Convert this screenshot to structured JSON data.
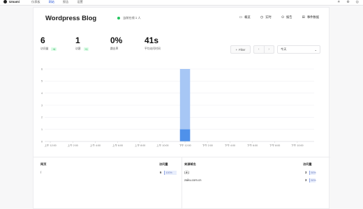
{
  "topbar": {
    "brand": "Umami",
    "nav": [
      "仪表板",
      "网站",
      "报告",
      "设置"
    ],
    "active_nav": 1
  },
  "site": {
    "title": "Wordpress Blog",
    "live": "当前在线 1 人"
  },
  "actions": [
    {
      "icon": "overview-icon",
      "glyph": "▭",
      "label": "概览"
    },
    {
      "icon": "realtime-icon",
      "glyph": "◷",
      "label": "实时"
    },
    {
      "icon": "reports-icon",
      "glyph": "⊙",
      "label": "报告"
    },
    {
      "icon": "events-icon",
      "glyph": "⊞",
      "label": "事件数据"
    }
  ],
  "stats": [
    {
      "value": "6",
      "label": "访问量",
      "badge": "+6"
    },
    {
      "value": "1",
      "label": "访客",
      "badge": "+1"
    },
    {
      "value": "0%",
      "label": "跳出率",
      "badge": ""
    },
    {
      "value": "41s",
      "label": "平均访问时间",
      "badge": ""
    }
  ],
  "filter": {
    "label": "Filter"
  },
  "period": {
    "value": "今天"
  },
  "chart_data": {
    "type": "bar",
    "categories": [
      "上午 12:00",
      "上午 2:00",
      "上午 4:00",
      "上午 6:00",
      "上午 8:00",
      "上午 10:00",
      "下午 12:00",
      "下午 2:00",
      "下午 4:00",
      "下午 6:00",
      "下午 8:00",
      "下午 10:00"
    ],
    "y_ticks": [
      0,
      1,
      2,
      3,
      4,
      5,
      6
    ],
    "ylim": [
      0,
      6
    ],
    "hour_slots": 24,
    "series": [
      {
        "color": "#a7c7f5",
        "points": [
          {
            "hour": 12,
            "value": 6
          }
        ]
      },
      {
        "color": "#4f91ea",
        "points": [
          {
            "hour": 12,
            "value": 1
          }
        ]
      }
    ],
    "grid": true
  },
  "pages": {
    "header": "网页",
    "count_header": "访问量",
    "rows": [
      {
        "label": "/",
        "count": "6",
        "pct": "100%",
        "share": 1.0
      }
    ]
  },
  "referrers": {
    "header": "来源域名",
    "count_header": "访问量",
    "rows": [
      {
        "label": "(无)",
        "count": "3",
        "pct": "50%",
        "share": 0.5
      },
      {
        "label": "zaiku.com.cn",
        "count": "3",
        "pct": "50%",
        "share": 0.5
      }
    ]
  }
}
